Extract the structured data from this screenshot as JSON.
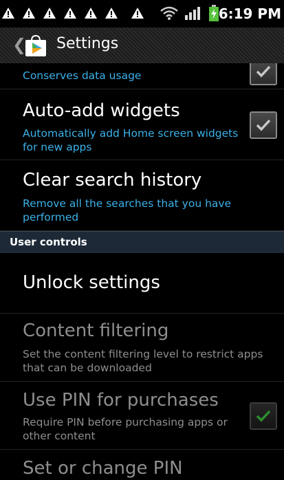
{
  "status_bar": {
    "time": "6:19 PM"
  },
  "action_bar": {
    "title": "Settings"
  },
  "settings": {
    "data_usage": {
      "summary": "Conserves data usage",
      "checked": true
    },
    "auto_add": {
      "title": "Auto-add widgets",
      "summary": "Automatically add Home screen widgets for new apps",
      "checked": true
    },
    "clear_history": {
      "title": "Clear search history",
      "summary": "Remove all the searches that you have performed"
    },
    "section_user_controls": "User controls",
    "unlock": {
      "title": "Unlock settings"
    },
    "content_filtering": {
      "title": "Content filtering",
      "summary": "Set the content filtering level to restrict apps that can be downloaded"
    },
    "use_pin": {
      "title": "Use PIN for purchases",
      "summary": "Require PIN before purchasing apps or other content",
      "checked": true
    },
    "change_pin": {
      "title": "Set or change PIN"
    }
  },
  "colors": {
    "accent_blue": "#3bb1e8",
    "section_header_bg": "#1e2937",
    "disabled_text": "#8e8e8e",
    "check_green": "#2f8f2f"
  }
}
